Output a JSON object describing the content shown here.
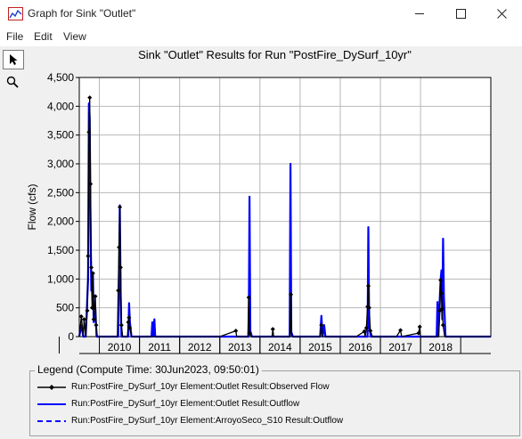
{
  "window": {
    "title": "Graph for Sink \"Outlet\"",
    "controls": {
      "minimize_icon": "minimize-icon",
      "maximize_icon": "maximize-icon",
      "close_icon": "close-icon"
    }
  },
  "menu": {
    "file": "File",
    "edit": "Edit",
    "view": "View"
  },
  "toolbar": {
    "tools": [
      "pointer-icon",
      "zoom-icon"
    ]
  },
  "colors": {
    "observed": "#000000",
    "outflow": "#0000ff",
    "grid": "#b8b8b8",
    "axis": "#000000",
    "plot_bg": "#ffffff"
  },
  "chart_data": {
    "type": "line",
    "title": "Sink \"Outlet\" Results for Run \"PostFire_DySurf_10yr\"",
    "xlabel": "",
    "ylabel": "Flow (cfs)",
    "ylim": [
      0,
      4500
    ],
    "yticks": [
      "0",
      "500",
      "1,000",
      "1,500",
      "2,000",
      "2,500",
      "3,000",
      "3,500",
      "4,000",
      "4,500"
    ],
    "xlim": [
      2009.5,
      2019.75
    ],
    "xticks": [
      "2010",
      "2011",
      "2012",
      "2013",
      "2014",
      "2015",
      "2016",
      "2017",
      "2018"
    ],
    "grid": true,
    "legend_position": "bottom",
    "series": [
      {
        "name": "Run:PostFire_DySurf_10yr Element:Outlet Result:Observed Flow",
        "style": "solid-with-markers",
        "points": [
          [
            2009.5,
            0
          ],
          [
            2009.55,
            350
          ],
          [
            2009.6,
            0
          ],
          [
            2009.62,
            300
          ],
          [
            2009.66,
            0
          ],
          [
            2009.7,
            450
          ],
          [
            2009.72,
            1400
          ],
          [
            2009.74,
            3550
          ],
          [
            2009.76,
            4150
          ],
          [
            2009.78,
            2650
          ],
          [
            2009.8,
            1200
          ],
          [
            2009.82,
            500
          ],
          [
            2009.84,
            1100
          ],
          [
            2009.86,
            300
          ],
          [
            2009.9,
            700
          ],
          [
            2009.92,
            200
          ],
          [
            2009.95,
            0
          ],
          [
            2010.45,
            0
          ],
          [
            2010.47,
            800
          ],
          [
            2010.49,
            1550
          ],
          [
            2010.51,
            2250
          ],
          [
            2010.53,
            1200
          ],
          [
            2010.55,
            200
          ],
          [
            2010.58,
            0
          ],
          [
            2010.7,
            0
          ],
          [
            2010.72,
            250
          ],
          [
            2010.74,
            330
          ],
          [
            2010.76,
            150
          ],
          [
            2010.8,
            0
          ],
          [
            2011.0,
            0
          ],
          [
            2011.5,
            0
          ],
          [
            2012.0,
            0
          ],
          [
            2012.5,
            0
          ],
          [
            2013.0,
            0
          ],
          [
            2013.4,
            100
          ],
          [
            2013.42,
            0
          ],
          [
            2013.7,
            0
          ],
          [
            2013.72,
            680
          ],
          [
            2013.74,
            60
          ],
          [
            2013.78,
            0
          ],
          [
            2014.3,
            0
          ],
          [
            2014.32,
            130
          ],
          [
            2014.34,
            0
          ],
          [
            2014.75,
            0
          ],
          [
            2014.77,
            730
          ],
          [
            2014.79,
            0
          ],
          [
            2015.5,
            0
          ],
          [
            2015.53,
            200
          ],
          [
            2015.56,
            0
          ],
          [
            2016.4,
            0
          ],
          [
            2016.6,
            90
          ],
          [
            2016.62,
            0
          ],
          [
            2016.65,
            150
          ],
          [
            2016.68,
            520
          ],
          [
            2016.7,
            880
          ],
          [
            2016.72,
            500
          ],
          [
            2016.75,
            100
          ],
          [
            2016.8,
            0
          ],
          [
            2017.4,
            0
          ],
          [
            2017.5,
            110
          ],
          [
            2017.53,
            0
          ],
          [
            2017.95,
            60
          ],
          [
            2017.98,
            170
          ],
          [
            2018.0,
            0
          ],
          [
            2018.45,
            0
          ],
          [
            2018.48,
            450
          ],
          [
            2018.5,
            980
          ],
          [
            2018.52,
            750
          ],
          [
            2018.54,
            480
          ],
          [
            2018.56,
            200
          ],
          [
            2018.6,
            0
          ],
          [
            2019.0,
            0
          ],
          [
            2019.75,
            0
          ]
        ]
      },
      {
        "name": "Run:PostFire_DySurf_10yr Element:Outlet Result:Outflow",
        "style": "solid",
        "points": [
          [
            2009.5,
            0
          ],
          [
            2009.55,
            200
          ],
          [
            2009.6,
            0
          ],
          [
            2009.66,
            0
          ],
          [
            2009.72,
            1000
          ],
          [
            2009.74,
            4050
          ],
          [
            2009.76,
            3800
          ],
          [
            2009.78,
            2000
          ],
          [
            2009.8,
            800
          ],
          [
            2009.84,
            1080
          ],
          [
            2009.86,
            250
          ],
          [
            2009.9,
            500
          ],
          [
            2009.93,
            0
          ],
          [
            2010.47,
            0
          ],
          [
            2010.49,
            1000
          ],
          [
            2010.51,
            2280
          ],
          [
            2010.53,
            800
          ],
          [
            2010.55,
            0
          ],
          [
            2010.72,
            0
          ],
          [
            2010.74,
            580
          ],
          [
            2010.76,
            250
          ],
          [
            2010.8,
            0
          ],
          [
            2011.3,
            0
          ],
          [
            2011.32,
            250
          ],
          [
            2011.34,
            0
          ],
          [
            2011.37,
            300
          ],
          [
            2011.39,
            0
          ],
          [
            2012.0,
            0
          ],
          [
            2013.72,
            0
          ],
          [
            2013.74,
            2430
          ],
          [
            2013.76,
            100
          ],
          [
            2013.8,
            0
          ],
          [
            2014.74,
            0
          ],
          [
            2014.76,
            3000
          ],
          [
            2014.78,
            80
          ],
          [
            2014.82,
            0
          ],
          [
            2015.5,
            0
          ],
          [
            2015.53,
            360
          ],
          [
            2015.56,
            0
          ],
          [
            2015.6,
            200
          ],
          [
            2015.63,
            0
          ],
          [
            2016.68,
            0
          ],
          [
            2016.7,
            1900
          ],
          [
            2016.72,
            200
          ],
          [
            2016.76,
            0
          ],
          [
            2018.4,
            0
          ],
          [
            2018.42,
            600
          ],
          [
            2018.44,
            0
          ],
          [
            2018.48,
            700
          ],
          [
            2018.5,
            1000
          ],
          [
            2018.52,
            1150
          ],
          [
            2018.54,
            300
          ],
          [
            2018.56,
            1700
          ],
          [
            2018.58,
            700
          ],
          [
            2018.62,
            0
          ],
          [
            2019.0,
            0
          ],
          [
            2019.75,
            0
          ]
        ]
      },
      {
        "name": "Run:PostFire_DySurf_10yr Element:ArroyoSeco_S10 Result:Outflow",
        "style": "dashed",
        "points": []
      }
    ]
  },
  "legend": {
    "title": "Legend (Compute Time: 30Jun2023, 09:50:01)",
    "entries": [
      "Run:PostFire_DySurf_10yr Element:Outlet Result:Observed Flow",
      "Run:PostFire_DySurf_10yr Element:Outlet Result:Outflow",
      "Run:PostFire_DySurf_10yr Element:ArroyoSeco_S10 Result:Outflow"
    ]
  }
}
